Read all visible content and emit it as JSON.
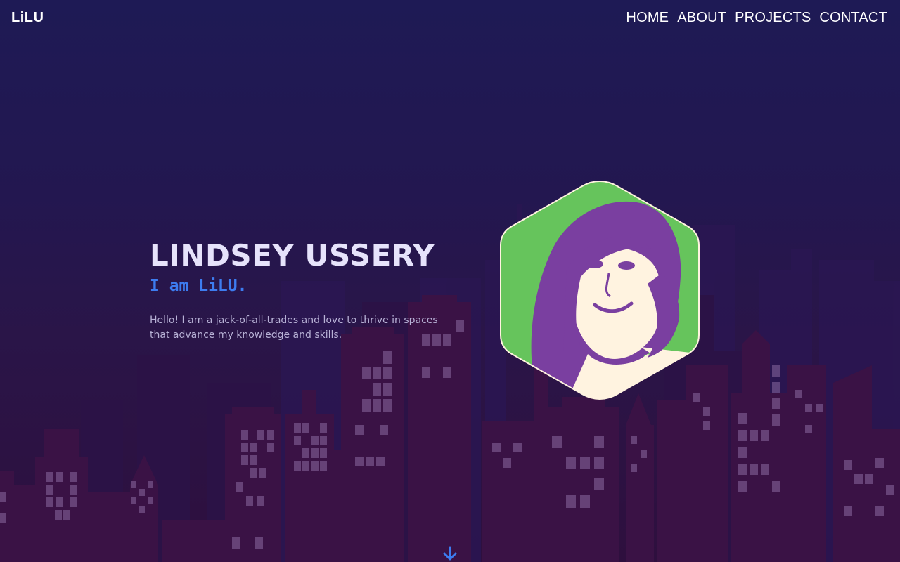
{
  "header": {
    "brand": "LiLU",
    "nav": [
      "HOME",
      "ABOUT",
      "PROJECTS",
      "CONTACT"
    ]
  },
  "hero": {
    "name": "LINDSEY USSERY",
    "tagline": "I am LiLU.",
    "intro": "Hello! I am a jack-of-all-trades and love to thrive in spaces that advance my knowledge and skills."
  },
  "colors": {
    "accent": "#3d7cf0",
    "portrait_bg": "#66c45c",
    "portrait_figure": "#7a3fa0",
    "portrait_skin": "#fff3e0"
  },
  "icons": {
    "scroll": "arrow-down-icon"
  }
}
